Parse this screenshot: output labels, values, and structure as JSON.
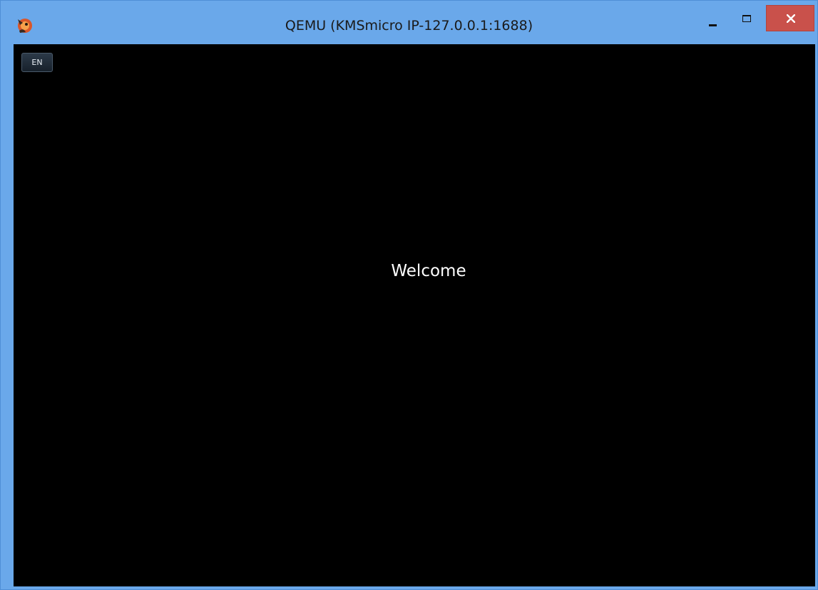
{
  "window": {
    "title": "QEMU (KMSmicro IP-127.0.0.1:1688)",
    "icon": "qemu-app-icon",
    "controls": {
      "minimize_icon": "minimize-icon",
      "maximize_icon": "maximize-icon",
      "close_icon": "close-icon"
    }
  },
  "screen": {
    "language_indicator": "EN",
    "message": "Welcome"
  },
  "colors": {
    "frame": "#6aa8ea",
    "close_button": "#c9514b",
    "screen_background": "#000000",
    "message_text": "#ffffff"
  }
}
